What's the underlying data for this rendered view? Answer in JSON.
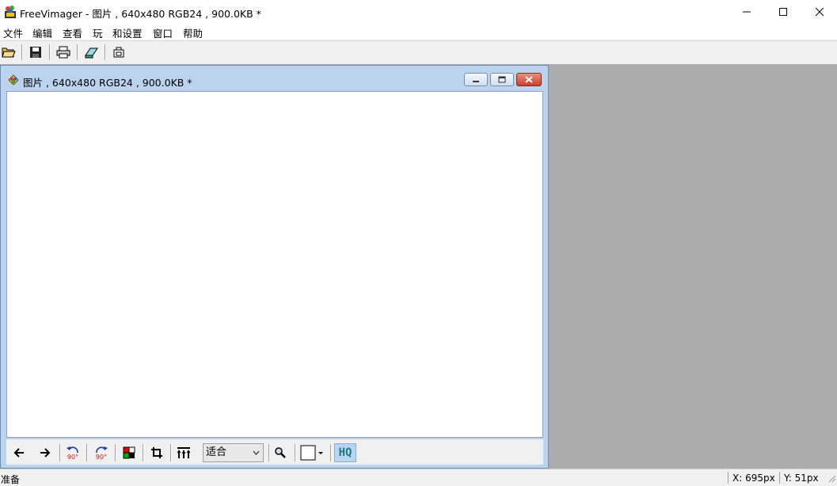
{
  "window": {
    "title": "FreeVimager - 图片 , 640x480 RGB24 , 900.0KB *"
  },
  "menu": [
    "文件",
    "编辑",
    "查看",
    "玩",
    "和设置",
    "窗口",
    "帮助"
  ],
  "toolbar": {
    "icons": [
      "open-folder-icon",
      "save-icon",
      "print-icon",
      "scan-icon",
      "screenshot-icon"
    ]
  },
  "child_window": {
    "title": "图片 , 640x480 RGB24 , 900.0KB *"
  },
  "image_toolbar": {
    "rotate_ccw_label": "90°",
    "rotate_cw_label": "90°",
    "zoom_value": "适合",
    "hq_label": "HQ"
  },
  "status": {
    "message": "准备",
    "x": "X: 695px",
    "y": "Y: 51px"
  },
  "colors": {
    "child_frame": "#bcd3ed",
    "mdi_background": "#ababab",
    "close_button": "#d04a38",
    "hq_active": "#b9d5f0"
  }
}
